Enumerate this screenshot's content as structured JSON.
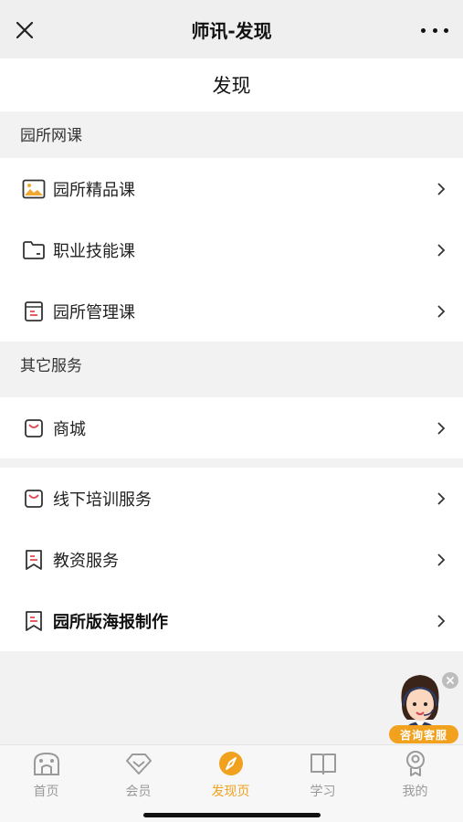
{
  "topbar": {
    "title": "师讯-发现"
  },
  "page": {
    "title": "发现"
  },
  "sections": {
    "online_courses": {
      "header": "园所网课",
      "items": [
        {
          "label": "园所精品课",
          "icon": "image-icon"
        },
        {
          "label": "职业技能课",
          "icon": "folder-icon"
        },
        {
          "label": "园所管理课",
          "icon": "document-icon"
        }
      ]
    },
    "other_services": {
      "header": "其它服务",
      "items": [
        {
          "label": "商城",
          "icon": "shopping-bag-icon"
        }
      ]
    },
    "more_services": {
      "items": [
        {
          "label": "线下培训服务",
          "icon": "shopping-bag-icon"
        },
        {
          "label": "教资服务",
          "icon": "bookmark-icon"
        },
        {
          "label": "园所版海报制作",
          "icon": "bookmark-icon"
        }
      ]
    }
  },
  "float_service": {
    "label": "咨询客服"
  },
  "tabbar": {
    "tabs": [
      {
        "label": "首页",
        "icon": "home-icon"
      },
      {
        "label": "会员",
        "icon": "diamond-icon"
      },
      {
        "label": "发现页",
        "icon": "compass-icon",
        "active": true
      },
      {
        "label": "学习",
        "icon": "book-icon"
      },
      {
        "label": "我的",
        "icon": "profile-icon"
      }
    ]
  },
  "colors": {
    "accent": "#f1a11d",
    "icon_red": "#e5454f",
    "icon_amber": "#f0a830"
  }
}
